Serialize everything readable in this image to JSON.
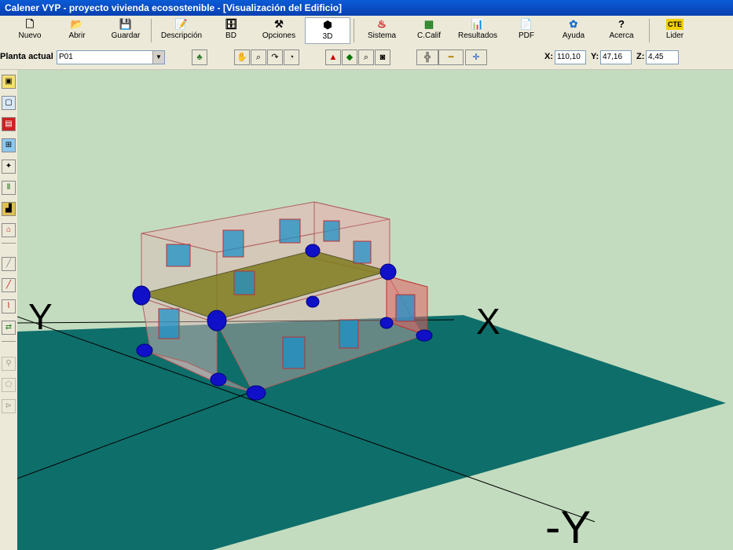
{
  "window": {
    "title": "Calener VYP - proyecto vivienda ecosostenible - [Visualización del Edificio]"
  },
  "toolbar": {
    "buttons": [
      {
        "label": "Nuevo",
        "icon": "new-document-icon",
        "glyph": "🗋"
      },
      {
        "label": "Abrir",
        "icon": "open-folder-icon",
        "glyph": "📂"
      },
      {
        "label": "Guardar",
        "icon": "save-disk-icon",
        "glyph": "💾"
      },
      {
        "label": "Descripción",
        "icon": "description-icon",
        "glyph": "📝"
      },
      {
        "label": "BD",
        "icon": "database-icon",
        "glyph": "🗄"
      },
      {
        "label": "Opciones",
        "icon": "hammer-icon",
        "glyph": "⚒"
      },
      {
        "label": "3D",
        "icon": "3d-view-icon",
        "glyph": "⬢"
      },
      {
        "label": "Sistema",
        "icon": "system-icon",
        "glyph": "♨"
      },
      {
        "label": "C.Calif",
        "icon": "calculator-icon",
        "glyph": "▦"
      },
      {
        "label": "Resultados",
        "icon": "results-chart-icon",
        "glyph": "📊"
      },
      {
        "label": "PDF",
        "icon": "pdf-icon",
        "glyph": "📄"
      },
      {
        "label": "Ayuda",
        "icon": "help-icon",
        "glyph": "✿"
      },
      {
        "label": "Acerca",
        "icon": "question-icon",
        "glyph": "?"
      },
      {
        "label": "Lider",
        "icon": "cte-lider-icon",
        "glyph": "CTE"
      }
    ]
  },
  "planta": {
    "label": "Planta actual",
    "value": "P01"
  },
  "coords": {
    "x_label": "X:",
    "x_value": "110,10",
    "y_label": "Y:",
    "y_value": "47,16",
    "z_label": "Z:",
    "z_value": "4,45"
  },
  "viewport": {
    "axis_y": "Y",
    "axis_x": "X",
    "axis_neg_y": "-Y",
    "colors": {
      "background": "#c3dcbf",
      "ground": "#0e6e6a",
      "floor_slab": "#7f7d1e",
      "window_blue": "#1e90c8",
      "vertex_blue": "#1010c8"
    }
  }
}
